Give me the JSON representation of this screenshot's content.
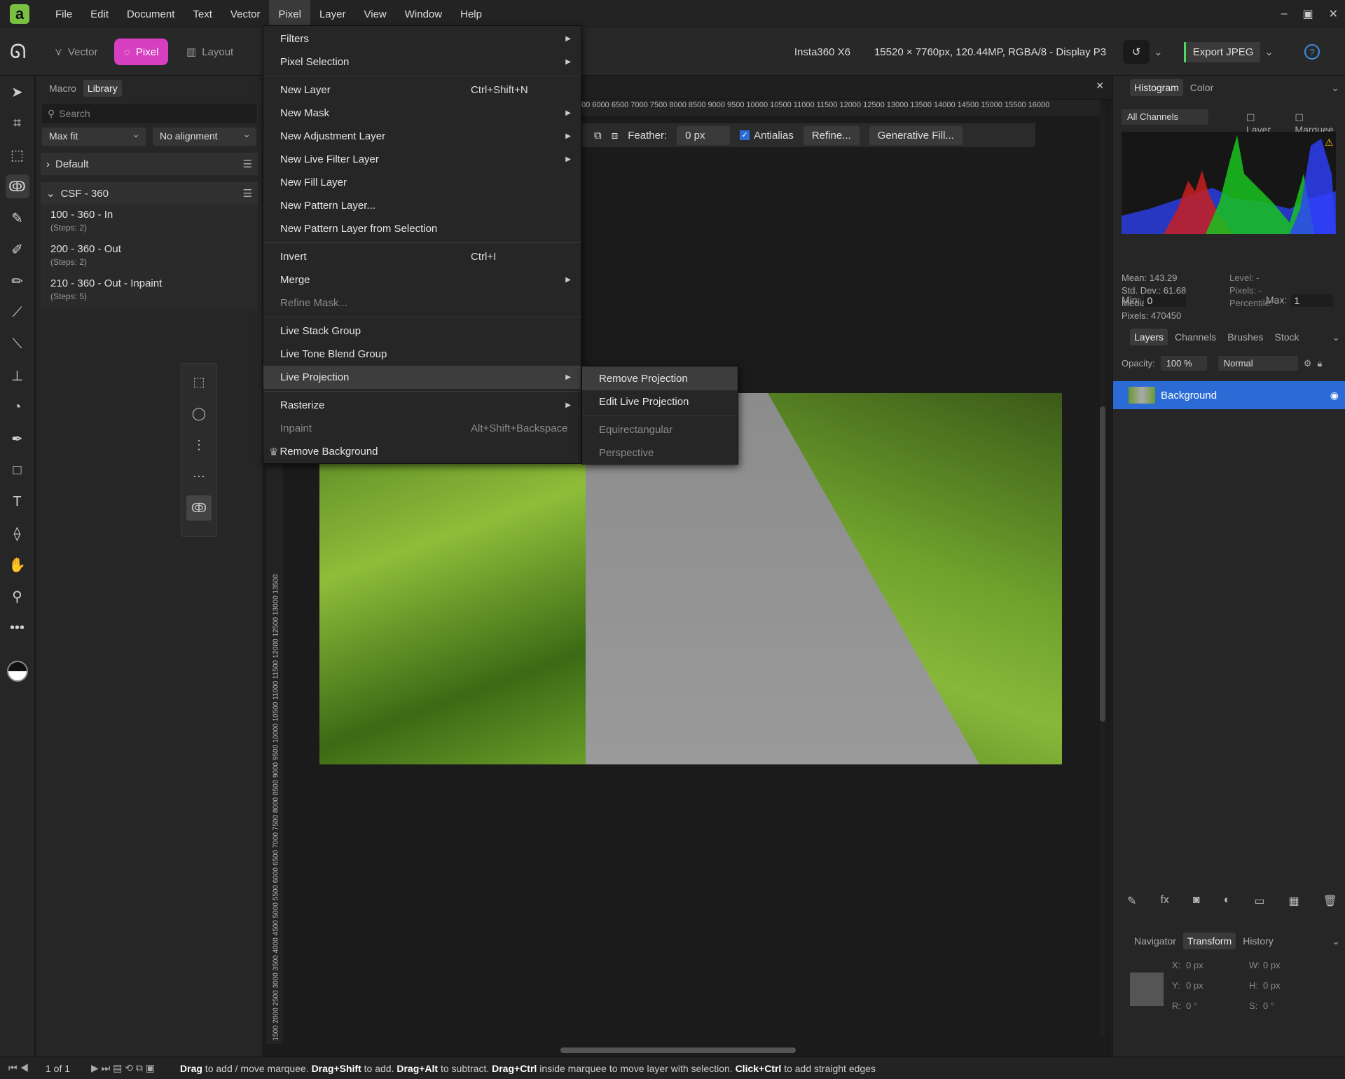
{
  "menubar": {
    "items": [
      "File",
      "Edit",
      "Document",
      "Text",
      "Vector",
      "Pixel",
      "Layer",
      "View",
      "Window",
      "Help"
    ],
    "active": "Pixel"
  },
  "personas": {
    "vector": "Vector",
    "pixel": "Pixel",
    "layout": "Layout"
  },
  "toolbar": {
    "camera": "Insta360 X6",
    "docinfo": "15520 × 7760px, 120.44MP, RGBA/8 - Display P3",
    "export": "Export JPEG"
  },
  "leftpanel": {
    "tabs": [
      "Macro",
      "Library"
    ],
    "search_placeholder": "Search",
    "fit": "Max fit",
    "align": "No alignment",
    "groups": [
      {
        "name": "Default"
      },
      {
        "name": "CSF - 360"
      }
    ],
    "macros": [
      {
        "name": "100 - 360 - In",
        "steps": "(Steps: 2)"
      },
      {
        "name": "200 - 360 - Out",
        "steps": "(Steps: 2)"
      },
      {
        "name": "210 - 360 - Out - Inpaint",
        "steps": "(Steps: 5)"
      }
    ]
  },
  "ruler": {
    "h": "00  6000   6500   7000   7500   8000   8500   9000   9500  10000 10500 11000 11500 12000 12500 13000 13500 14000 14500 15000 15500 16000",
    "v": "1500 2000 2500 3000 3500 4000 4500 5000 5500 6000 6500 7000 7500 8000 8500 9000 9500 10000 10500 11000 11500 12000 12500 13000 13500"
  },
  "context": {
    "feather_label": "Feather:",
    "feather": "0 px",
    "antialias": "Antialias",
    "refine": "Refine...",
    "genfill": "Generative Fill..."
  },
  "menu": {
    "items": [
      {
        "label": "Filters",
        "sub": true
      },
      {
        "label": "Pixel Selection",
        "sub": true
      },
      {
        "sep": true
      },
      {
        "label": "New Layer",
        "shortcut": "Ctrl+Shift+N"
      },
      {
        "label": "New Mask",
        "sub": true
      },
      {
        "label": "New Adjustment Layer",
        "sub": true
      },
      {
        "label": "New Live Filter Layer",
        "sub": true
      },
      {
        "label": "New Fill Layer"
      },
      {
        "label": "New Pattern Layer..."
      },
      {
        "label": "New Pattern Layer from Selection"
      },
      {
        "sep": true
      },
      {
        "label": "Invert",
        "shortcut": "Ctrl+I"
      },
      {
        "label": "Merge",
        "sub": true
      },
      {
        "label": "Refine Mask...",
        "disabled": true
      },
      {
        "sep": true
      },
      {
        "label": "Live Stack Group"
      },
      {
        "label": "Live Tone Blend Group"
      },
      {
        "label": "Live Projection",
        "sub": true,
        "highlight": true
      },
      {
        "sep": true
      },
      {
        "label": "Rasterize",
        "sub": true
      },
      {
        "label": "Inpaint",
        "shortcut": "Alt+Shift+Backspace",
        "disabled": true
      },
      {
        "label": "Remove Background",
        "crown": true
      }
    ],
    "submenu": [
      {
        "label": "Remove Projection",
        "highlight": true
      },
      {
        "label": "Edit Live Projection"
      },
      {
        "sep": true
      },
      {
        "label": "Equirectangular",
        "disabled": true
      },
      {
        "label": "Perspective",
        "disabled": true
      }
    ]
  },
  "rightpanel": {
    "histo_tabs": [
      "Histogram",
      "Color"
    ],
    "channels": "All Channels",
    "layer_cb": "Layer",
    "marquee_cb": "Marquee",
    "stats": {
      "mean": "Mean: 143.29",
      "std": "Std. Dev.: 61.68",
      "median": "Median: 153",
      "pixels": "Pixels: 470450",
      "level": "Level: -",
      "pixels2": "Pixels: -",
      "percentile": "Percentile: -"
    },
    "min_label": "Min:",
    "min": "0",
    "max_label": "Max:",
    "max": "1",
    "layer_tabs": [
      "Layers",
      "Channels",
      "Brushes",
      "Stock"
    ],
    "opacity_label": "Opacity:",
    "opacity": "100 %",
    "blend": "Normal",
    "layer_name": "Background",
    "nav_tabs": [
      "Navigator",
      "Transform",
      "History"
    ],
    "transform": {
      "x_label": "X:",
      "x": "0 px",
      "y_label": "Y:",
      "y": "0 px",
      "w_label": "W:",
      "w": "0 px",
      "h_label": "H:",
      "h": "0 px",
      "r_label": "R:",
      "r": "0 °",
      "s_label": "S:",
      "s": "0 °"
    }
  },
  "status": {
    "page": "1 of 1",
    "hint": [
      [
        "Drag",
        " to add / move marquee. "
      ],
      [
        "Drag+Shift",
        " to add. "
      ],
      [
        "Drag+Alt",
        " to subtract. "
      ],
      [
        "Drag+Ctrl",
        " inside marquee to move layer with selection. "
      ],
      [
        "Click+Ctrl",
        " to add straight edges"
      ]
    ]
  },
  "histogram": {
    "colors": {
      "red": "#c81e1e",
      "green": "#19c31e",
      "blue": "#2b3de0"
    }
  }
}
